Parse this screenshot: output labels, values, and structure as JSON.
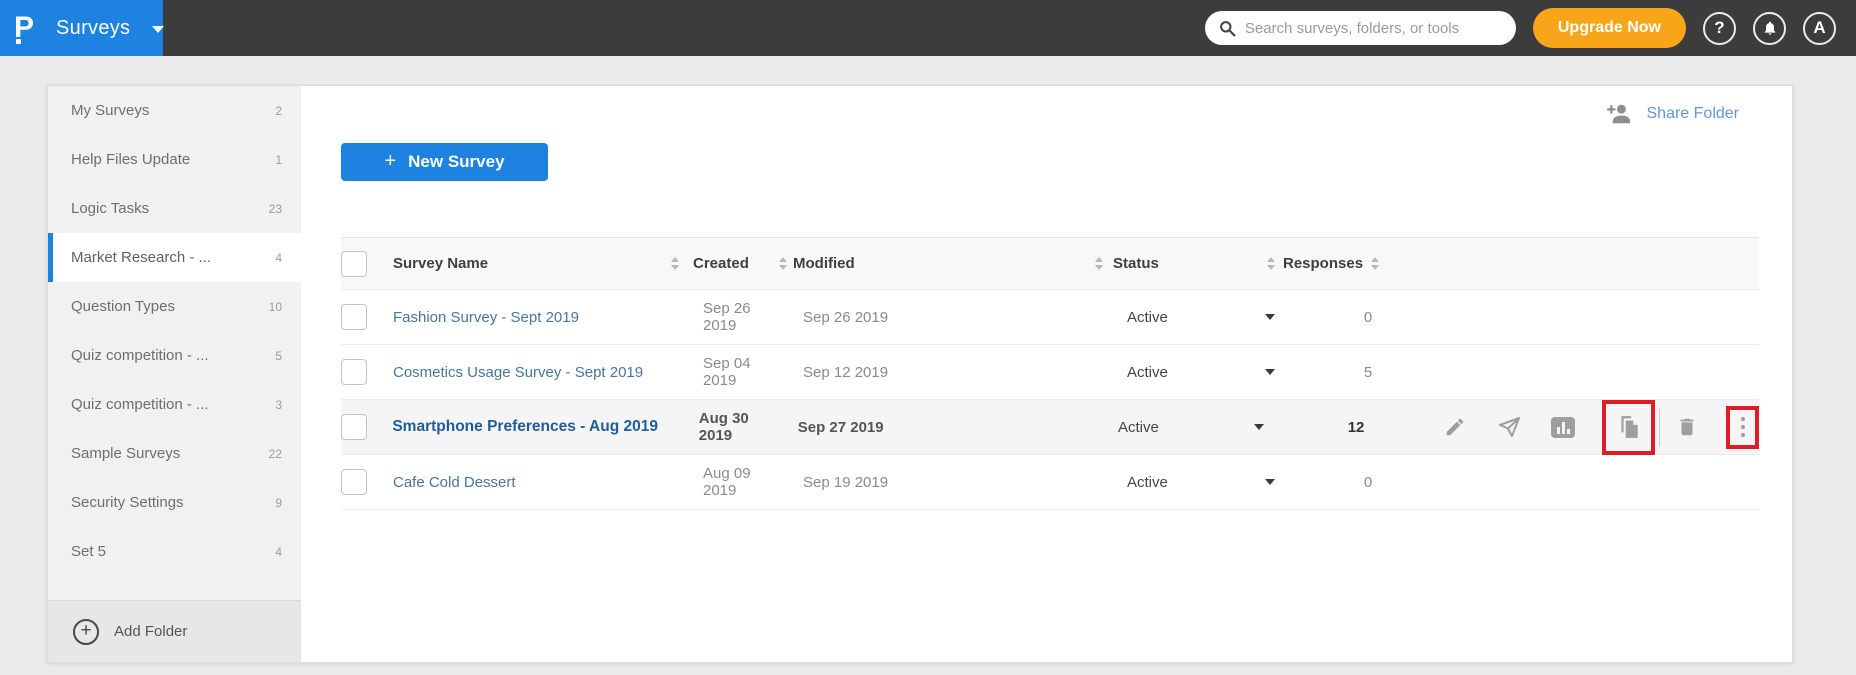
{
  "topbar": {
    "logo_letter": "P",
    "product": "Surveys",
    "search_placeholder": "Search surveys, folders, or tools",
    "upgrade_label": "Upgrade Now",
    "help_glyph": "?",
    "avatar_letter": "A"
  },
  "sidebar": {
    "items": [
      {
        "label": "My Surveys",
        "count": "2"
      },
      {
        "label": "Help Files Update",
        "count": "1"
      },
      {
        "label": "Logic Tasks",
        "count": "23"
      },
      {
        "label": "Market Research - ...",
        "count": "4",
        "active": true
      },
      {
        "label": "Question Types",
        "count": "10"
      },
      {
        "label": "Quiz competition - ...",
        "count": "5"
      },
      {
        "label": "Quiz competition - ...",
        "count": "3"
      },
      {
        "label": "Sample Surveys",
        "count": "22"
      },
      {
        "label": "Security Settings",
        "count": "9"
      },
      {
        "label": "Set 5",
        "count": "4"
      }
    ],
    "add_folder_label": "Add Folder"
  },
  "main": {
    "share_folder_label": "Share Folder",
    "new_survey_label": "New Survey",
    "table": {
      "headers": [
        "Survey Name",
        "Created",
        "Modified",
        "Status",
        "Responses"
      ],
      "rows": [
        {
          "name": "Fashion Survey - Sept 2019",
          "created": "Sep 26 2019",
          "modified": "Sep 26 2019",
          "status": "Active",
          "responses": "0"
        },
        {
          "name": "Cosmetics Usage Survey - Sept 2019",
          "created": "Sep 04 2019",
          "modified": "Sep 12 2019",
          "status": "Active",
          "responses": "5"
        },
        {
          "name": "Smartphone Preferences - Aug 2019",
          "created": "Aug 30 2019",
          "modified": "Sep 27 2019",
          "status": "Active",
          "responses": "12",
          "highlighted": true
        },
        {
          "name": "Cafe Cold Dessert",
          "created": "Aug 09 2019",
          "modified": "Sep 19 2019",
          "status": "Active",
          "responses": "0"
        }
      ]
    }
  },
  "icons": {
    "logo": "proprofs-p",
    "search": "magnifier",
    "notifications": "bell",
    "share": "person-add",
    "add_folder": "circle-plus",
    "row_actions": [
      "pencil",
      "paper-plane",
      "bar-chart",
      "copy-pages",
      "trash",
      "vertical-dots"
    ]
  },
  "colors": {
    "brand_blue": "#1e82e0",
    "accent_orange": "#f9a51a",
    "highlight_red": "#e11c26",
    "topbar_gray": "#3c3c3c",
    "link_blue": "#6593d6",
    "survey_link": "#4a7599"
  }
}
